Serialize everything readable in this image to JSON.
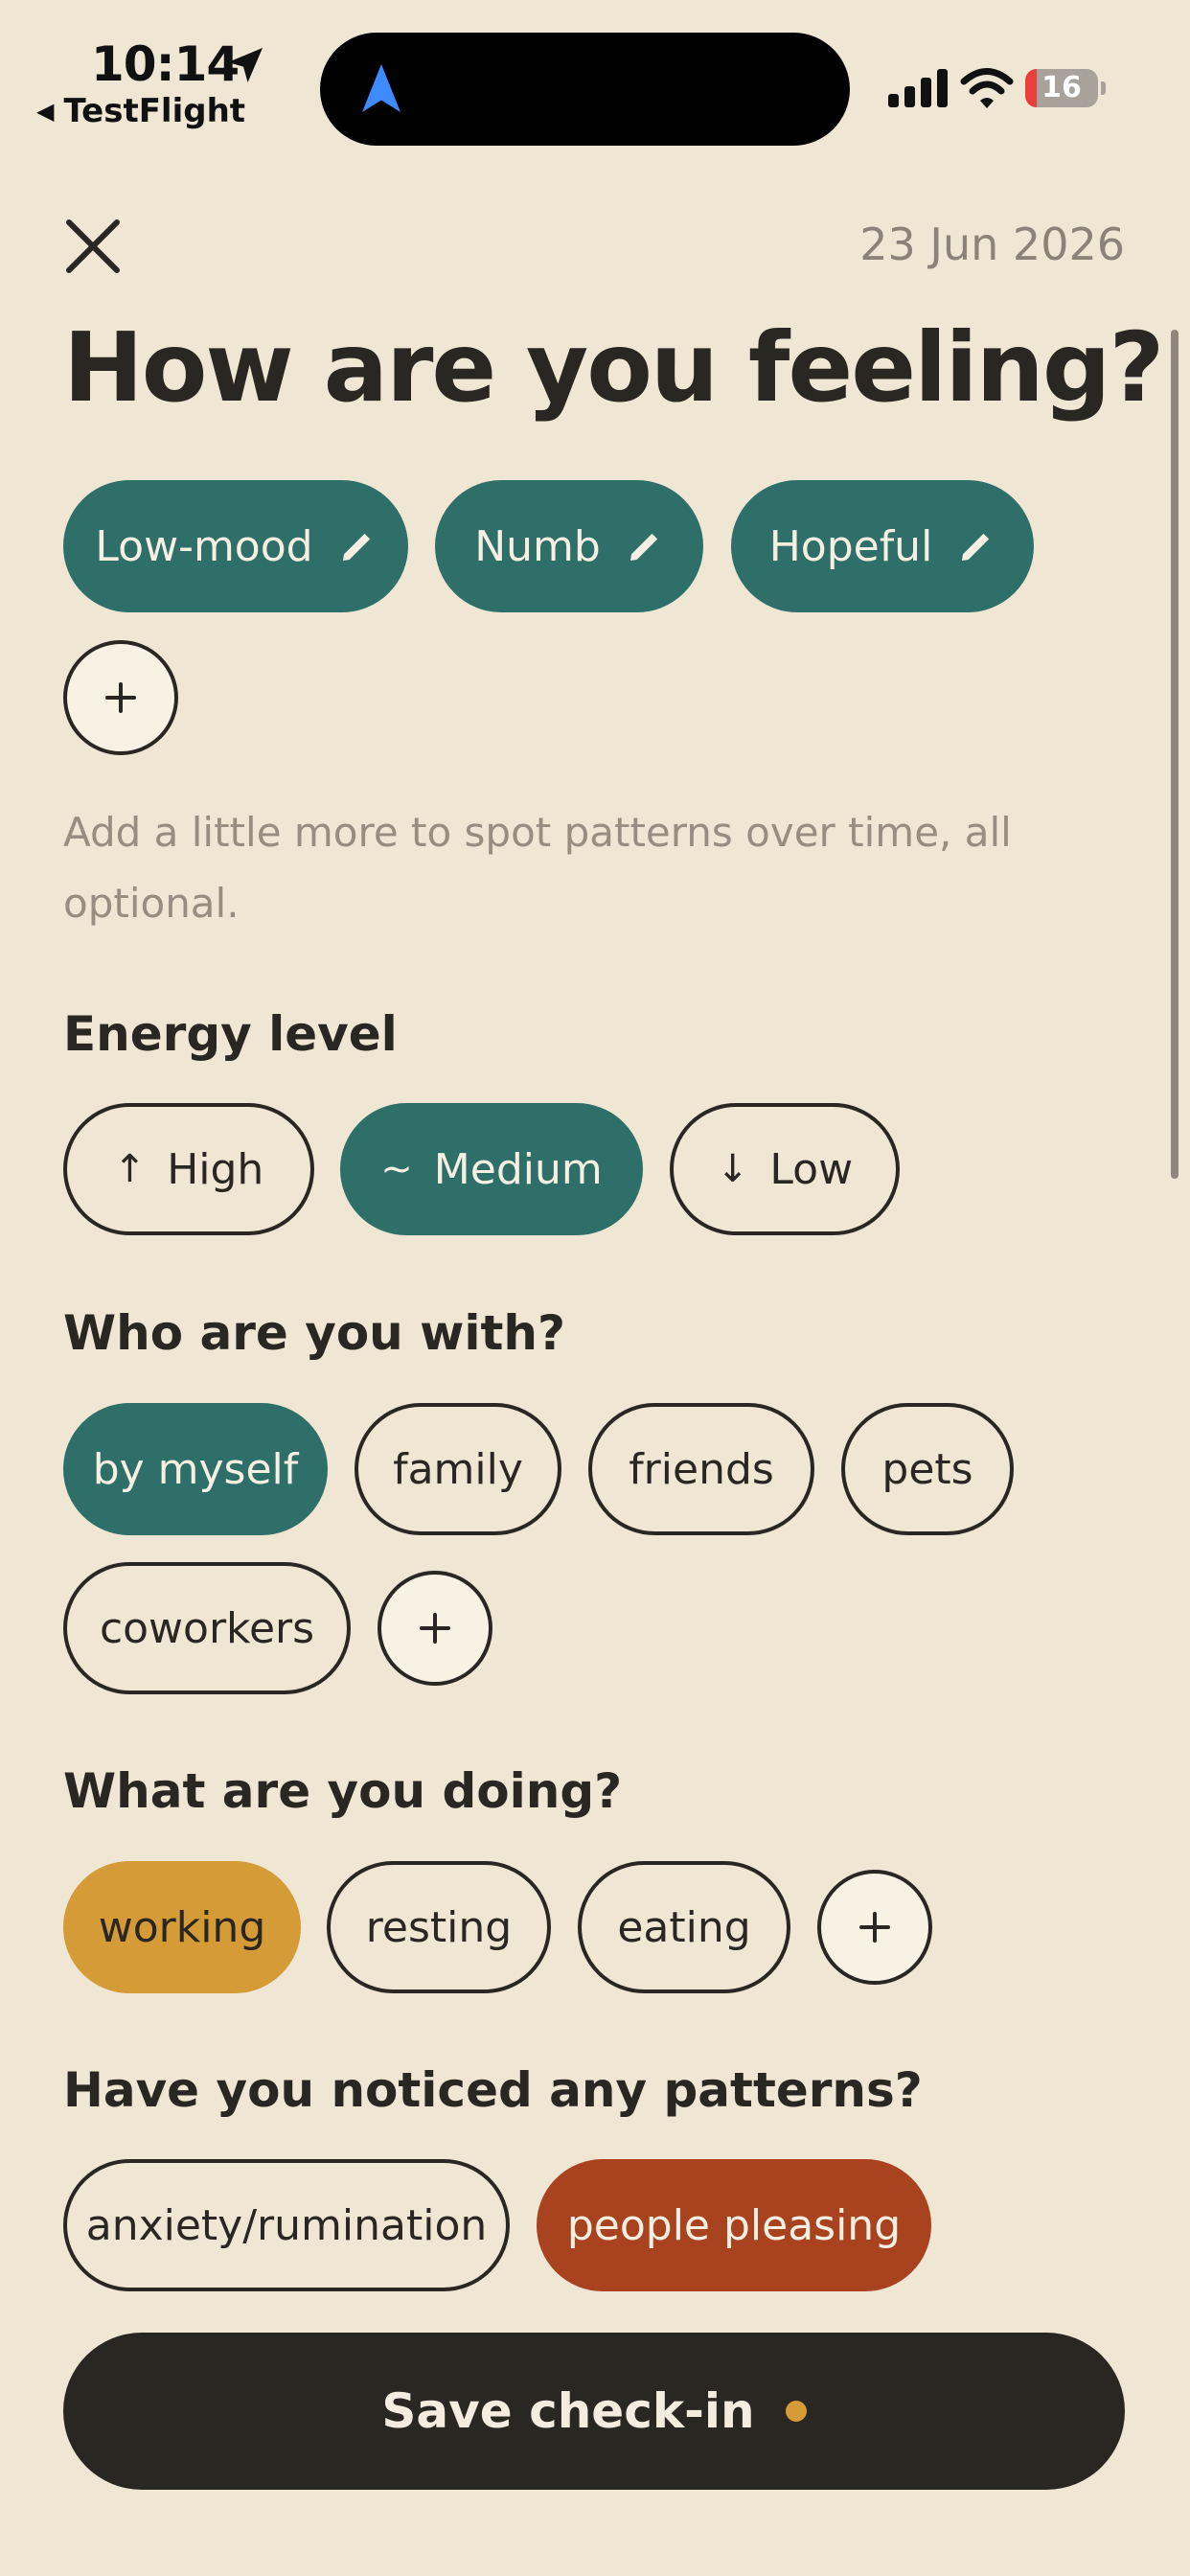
{
  "status_bar": {
    "time": "10:14",
    "back_app": "TestFlight",
    "battery": 16
  },
  "header": {
    "date": "23 Jun 2026",
    "title": "How are you feeling?"
  },
  "feelings": [
    {
      "label": "Low-mood"
    },
    {
      "label": "Numb"
    },
    {
      "label": "Hopeful"
    }
  ],
  "hint": "Add a little more to spot patterns over time, all optional.",
  "energy": {
    "title": "Energy level",
    "options": [
      {
        "glyph": "↑",
        "label": "High",
        "selected": false
      },
      {
        "glyph": "~",
        "label": "Medium",
        "selected": true
      },
      {
        "glyph": "↓",
        "label": "Low",
        "selected": false
      }
    ]
  },
  "company": {
    "title": "Who are you with?",
    "options": [
      {
        "label": "by myself",
        "selected": true
      },
      {
        "label": "family",
        "selected": false
      },
      {
        "label": "friends",
        "selected": false
      },
      {
        "label": "pets",
        "selected": false
      },
      {
        "label": "coworkers",
        "selected": false
      }
    ]
  },
  "activity": {
    "title": "What are you doing?",
    "options": [
      {
        "label": "working",
        "selected": true
      },
      {
        "label": "resting",
        "selected": false
      },
      {
        "label": "eating",
        "selected": false
      }
    ]
  },
  "patterns": {
    "title": "Have you noticed any patterns?",
    "options": [
      {
        "label": "anxiety/rumination",
        "selected": false
      },
      {
        "label": "people pleasing",
        "selected": true
      }
    ]
  },
  "save_label": "Save check-in",
  "colors": {
    "background": "#EFE6D4",
    "teal": "#2E6F6A",
    "amber": "#D49B36",
    "rust": "#A8421F",
    "dark": "#2A2622"
  }
}
